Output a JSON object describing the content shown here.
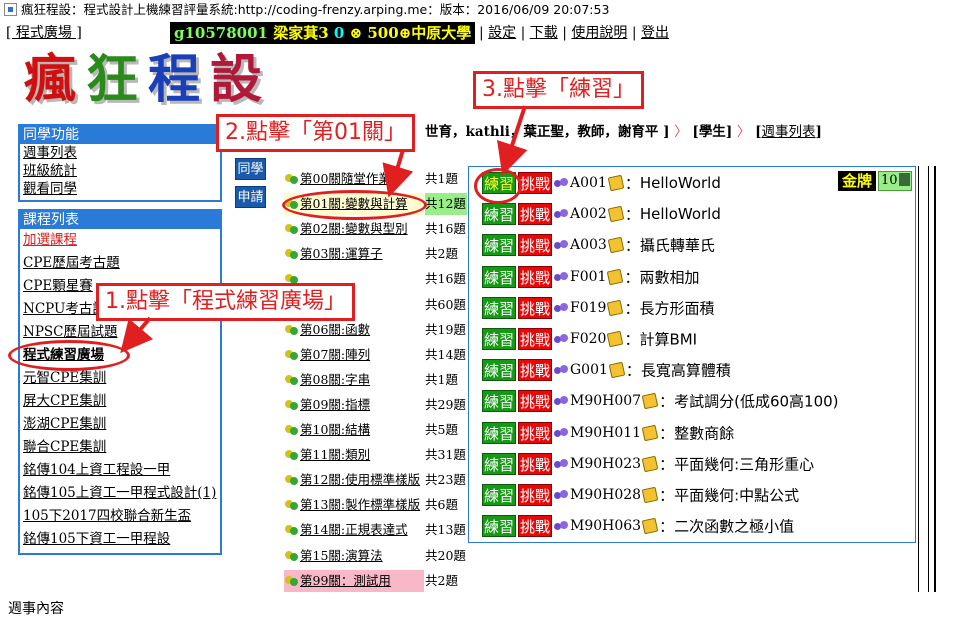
{
  "window": {
    "title": "瘋狂程設：程式設計上機練習評量系統:http://coding-frenzy.arping.me：版本：2016/06/09 20:07:53"
  },
  "topmenu": {
    "plaza": "[ 程式廣場 ]"
  },
  "userbar": {
    "uid": "g10578001",
    "name": "梁家萁3",
    "zero": "0",
    "coin_icon": "⊗",
    "score": "500",
    "plus_icon": "⊕",
    "school": "中原大學"
  },
  "rightmenu": [
    "設定",
    "下載",
    "使用說明",
    "登出"
  ],
  "logo": [
    "瘋",
    "狂",
    "程",
    "設"
  ],
  "panel1": {
    "title": "同學功能",
    "items": [
      "週事列表",
      "班級統計",
      "觀看同學"
    ]
  },
  "panel2": {
    "title": "課程列表",
    "items": [
      "加選課程",
      "CPE歷屆考古題",
      "CPE顆星賽",
      "NCPU考古試",
      "NPSC歷屆試題",
      "程式練習廣場",
      "元智CPE集訓",
      "屏大CPE集訓",
      "澎湖CPE集訓",
      "聯合CPE集訓",
      "銘傳104上資工程設一甲",
      "銘傳105上資工一甲程式設計(1)",
      "105下2017四校聯合新生盃",
      "銘傳105下資工一甲程設"
    ]
  },
  "breadcrumb": {
    "teacher_part": "世育，kathli，葉正聖，教師，謝育平",
    "sep": "〉",
    "role": "學生",
    "list": "週事列表"
  },
  "sidebuttons": [
    "同學",
    "申請"
  ],
  "chapters": [
    {
      "label": "第00關隨堂作業",
      "count": "共1題"
    },
    {
      "label": "第01關:變數與計算",
      "count": "共12題"
    },
    {
      "label": "第02關:變數與型別",
      "count": "共16題"
    },
    {
      "label": "第03關:運算子",
      "count": "共2題"
    },
    {
      "label": "",
      "count": "共16題"
    },
    {
      "label": "",
      "count": "共60題"
    },
    {
      "label": "第06關:函數",
      "count": "共19題"
    },
    {
      "label": "第07關:陣列",
      "count": "共14題"
    },
    {
      "label": "第08關:字串",
      "count": "共1題"
    },
    {
      "label": "第09關:指標",
      "count": "共29題"
    },
    {
      "label": "第10關:結構",
      "count": "共5題"
    },
    {
      "label": "第11關:類別",
      "count": "共31題"
    },
    {
      "label": "第12關:使用標準樣版",
      "count": "共23題"
    },
    {
      "label": "第13關:製作標準樣版",
      "count": "共6題"
    },
    {
      "label": "第14關:正規表達式",
      "count": "共13題"
    },
    {
      "label": "第15關:演算法",
      "count": "共20題"
    },
    {
      "label": "第99關：測試用",
      "count": "共2題"
    }
  ],
  "problems": {
    "practice_label": "練習",
    "challenge_label": "挑戰",
    "colon": "：",
    "items": [
      {
        "code": "A001",
        "title": "HelloWorld"
      },
      {
        "code": "A002",
        "title": "HelloWorld"
      },
      {
        "code": "A003",
        "title": "攝氏轉華氏"
      },
      {
        "code": "F001",
        "title": "兩數相加"
      },
      {
        "code": "F019",
        "title": "長方形面積"
      },
      {
        "code": "F020",
        "title": "計算BMI"
      },
      {
        "code": "G001",
        "title": "長寬高算體積"
      },
      {
        "code": "M90H007",
        "title": "考試調分(低成60高100)"
      },
      {
        "code": "M90H011",
        "title": "整數商餘"
      },
      {
        "code": "M90H023",
        "title": "平面幾何:三角形重心"
      },
      {
        "code": "M90H028",
        "title": "平面幾何:中點公式"
      },
      {
        "code": "M90H063",
        "title": "二次函數之極小值"
      }
    ]
  },
  "medal": {
    "label": "金牌",
    "count": "10"
  },
  "footer": "週事內容",
  "annotations": {
    "step1": "1.點擊「程式練習廣場」",
    "step2": "2.點擊「第01關」",
    "step3": "3.點擊「練習」"
  },
  "colors": {
    "accent": "#2a7ad8",
    "annotation": "#e02020",
    "practice": "#169a16",
    "challenge": "#e80808"
  }
}
